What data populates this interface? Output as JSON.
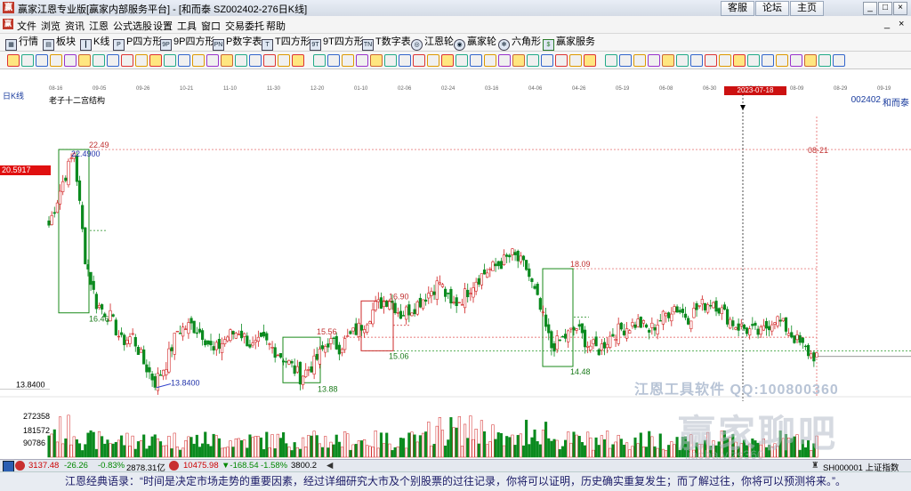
{
  "window": {
    "title": "赢家江恩专业版[赢家内部服务平台] - [和而泰  SZ002402-276日K线]",
    "app_icon_glyph": "赢",
    "top_buttons": [
      "客服",
      "论坛",
      "主页"
    ],
    "win_controls": [
      "_",
      "□",
      "×"
    ]
  },
  "menu": {
    "items": [
      "文件",
      "浏览",
      "资讯",
      "江恩",
      "公式选股",
      "设置",
      "工具",
      "窗口",
      "交易委托",
      "帮助"
    ],
    "right_controls": [
      "_",
      "×"
    ]
  },
  "toolbar1": {
    "items": [
      "行情",
      "板块",
      "K线",
      "P四方形",
      "9P四方形",
      "P数字表",
      "T四方形",
      "9T四方形",
      "T数字表",
      "江恩轮",
      "赢家轮",
      "六角形",
      "赢家服务"
    ]
  },
  "chart_header": {
    "period": "日K线",
    "code": "002402",
    "name": "和而泰",
    "structure_label": "老子十二宫结构",
    "selected_date": "2023-07-18",
    "date_labels": [
      "08-16",
      "09-05",
      "09-26",
      "10-21",
      "11-10",
      "11-30",
      "12-20",
      "01-10",
      "02-06",
      "02-24",
      "03-16",
      "04-06",
      "04-26",
      "05-19",
      "06-08",
      "06-30",
      "07-18",
      "08-09",
      "08-29",
      "09-19"
    ],
    "current_price_tag": "20.5917"
  },
  "chart_data": {
    "type": "candlestick",
    "title": "",
    "annotations": [
      {
        "text": "22.4900",
        "kind": "high"
      },
      {
        "text": "22.49",
        "kind": "level"
      },
      {
        "text": "16.46",
        "kind": "level"
      },
      {
        "text": "13.8400",
        "kind": "low"
      },
      {
        "text": "13.88",
        "kind": "level"
      },
      {
        "text": "15.56",
        "kind": "level"
      },
      {
        "text": "16.90",
        "kind": "level"
      },
      {
        "text": "15.06",
        "kind": "level"
      },
      {
        "text": "18.09",
        "kind": "level"
      },
      {
        "text": "14.48",
        "kind": "level"
      },
      {
        "text": "08-21",
        "kind": "date"
      }
    ],
    "price_range": [
      13.2,
      24.2
    ],
    "price_axis_label": "13.8400",
    "volume_labels": [
      "272358",
      "181572",
      "90786"
    ],
    "note": "approx. 276 daily candles; price path estimated from the chart",
    "keypoints": [
      [
        0,
        19.7
      ],
      [
        5,
        21.3
      ],
      [
        9,
        22.4
      ],
      [
        13,
        18.5
      ],
      [
        17,
        16.8
      ],
      [
        22,
        16.3
      ],
      [
        26,
        15.4
      ],
      [
        30,
        15.6
      ],
      [
        34,
        14.6
      ],
      [
        38,
        13.9
      ],
      [
        42,
        14.6
      ],
      [
        46,
        15.8
      ],
      [
        51,
        16.0
      ],
      [
        55,
        15.7
      ],
      [
        59,
        15.0
      ],
      [
        64,
        15.6
      ],
      [
        68,
        15.8
      ],
      [
        73,
        15.2
      ],
      [
        77,
        15.4
      ],
      [
        82,
        15.0
      ],
      [
        86,
        14.6
      ],
      [
        90,
        14.1
      ],
      [
        95,
        14.6
      ],
      [
        100,
        15.4
      ],
      [
        104,
        15.2
      ],
      [
        108,
        15.6
      ],
      [
        113,
        16.1
      ],
      [
        117,
        16.7
      ],
      [
        122,
        17.0
      ],
      [
        126,
        16.4
      ],
      [
        131,
        16.7
      ],
      [
        135,
        17.1
      ],
      [
        140,
        17.6
      ],
      [
        144,
        16.7
      ],
      [
        148,
        17.0
      ],
      [
        153,
        17.7
      ],
      [
        157,
        18.0
      ],
      [
        162,
        18.3
      ],
      [
        166,
        18.6
      ],
      [
        171,
        18.1
      ],
      [
        175,
        16.9
      ],
      [
        180,
        15.2
      ],
      [
        184,
        15.5
      ],
      [
        189,
        15.9
      ],
      [
        193,
        15.3
      ],
      [
        197,
        15.1
      ],
      [
        202,
        15.7
      ],
      [
        206,
        15.9
      ],
      [
        211,
        16.1
      ],
      [
        215,
        15.8
      ],
      [
        220,
        16.3
      ],
      [
        224,
        16.7
      ],
      [
        229,
        16.3
      ],
      [
        233,
        16.7
      ],
      [
        238,
        16.9
      ],
      [
        242,
        16.4
      ],
      [
        246,
        16.0
      ],
      [
        251,
        15.8
      ],
      [
        255,
        15.7
      ],
      [
        260,
        16.3
      ],
      [
        264,
        15.9
      ],
      [
        269,
        15.3
      ],
      [
        273,
        14.9
      ]
    ]
  },
  "taskbar": {
    "sh_index": "3137.48",
    "sh_change": "-26.26",
    "sh_pct": "-0.83%",
    "sh_amount": "2878.31亿",
    "sz_index": "10475.98",
    "sz_change": "▼-168.54",
    "sz_pct": "-1.58%",
    "sz_amount": "3800.2",
    "right_label": "SH000001 上证指数"
  },
  "watermark": {
    "line1": "江恩工具软件  QQ:100800360",
    "line2": "赢家聊吧",
    "line3": "liaoba.yjzs360"
  },
  "footer": {
    "text": "江恩经典语录：“时间是决定市场走势的重要因素，经过详细研究大市及个别股票的过往记录，你将可以证明，历史确实重复发生；而了解过往，你将可以预测将来。”。"
  }
}
